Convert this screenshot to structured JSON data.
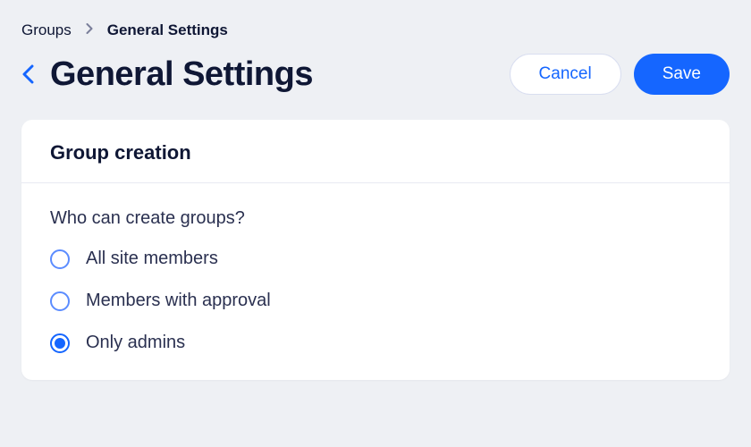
{
  "breadcrumb": {
    "parent": "Groups",
    "current": "General Settings"
  },
  "header": {
    "title": "General Settings",
    "cancel_label": "Cancel",
    "save_label": "Save"
  },
  "card": {
    "title": "Group creation",
    "question": "Who can create groups?",
    "options": [
      {
        "label": "All site members",
        "selected": false
      },
      {
        "label": "Members with approval",
        "selected": false
      },
      {
        "label": "Only admins",
        "selected": true
      }
    ]
  }
}
